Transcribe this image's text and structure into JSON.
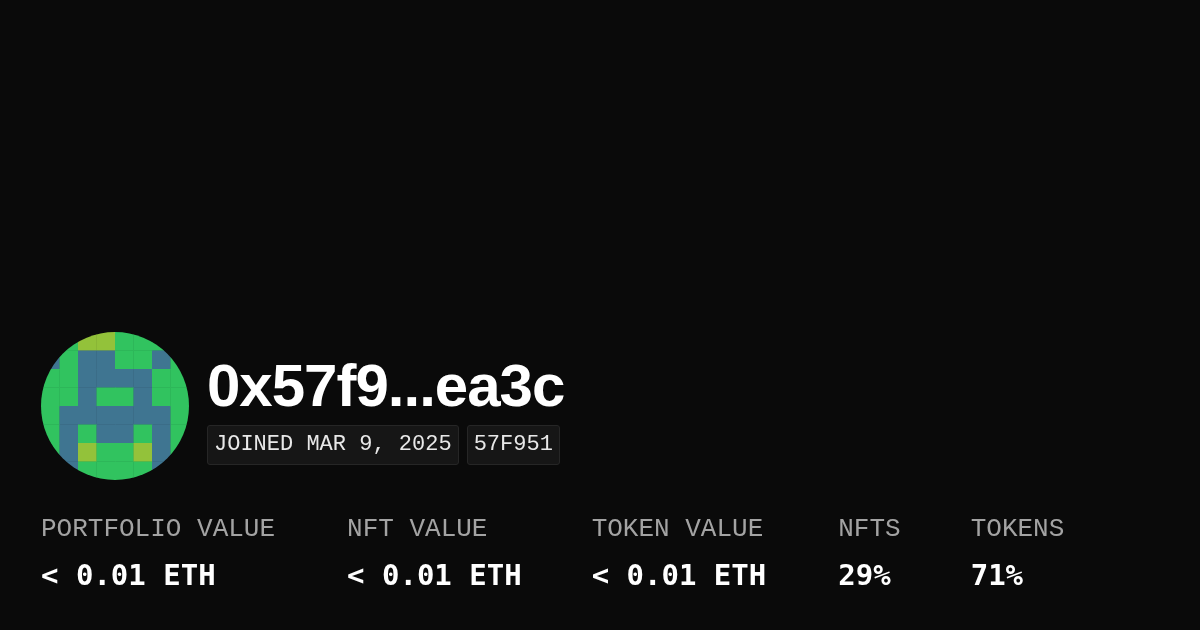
{
  "profile": {
    "address": "0x57f9...ea3c",
    "badges": [
      "JOINED MAR 9, 2025",
      "57F951"
    ]
  },
  "stats": [
    {
      "label": "PORTFOLIO VALUE",
      "value": "< 0.01 ETH"
    },
    {
      "label": "NFT VALUE",
      "value": "< 0.01 ETH"
    },
    {
      "label": "TOKEN VALUE",
      "value": "< 0.01 ETH"
    },
    {
      "label": "NFTS",
      "value": "29%"
    },
    {
      "label": "TOKENS",
      "value": "71%"
    }
  ]
}
